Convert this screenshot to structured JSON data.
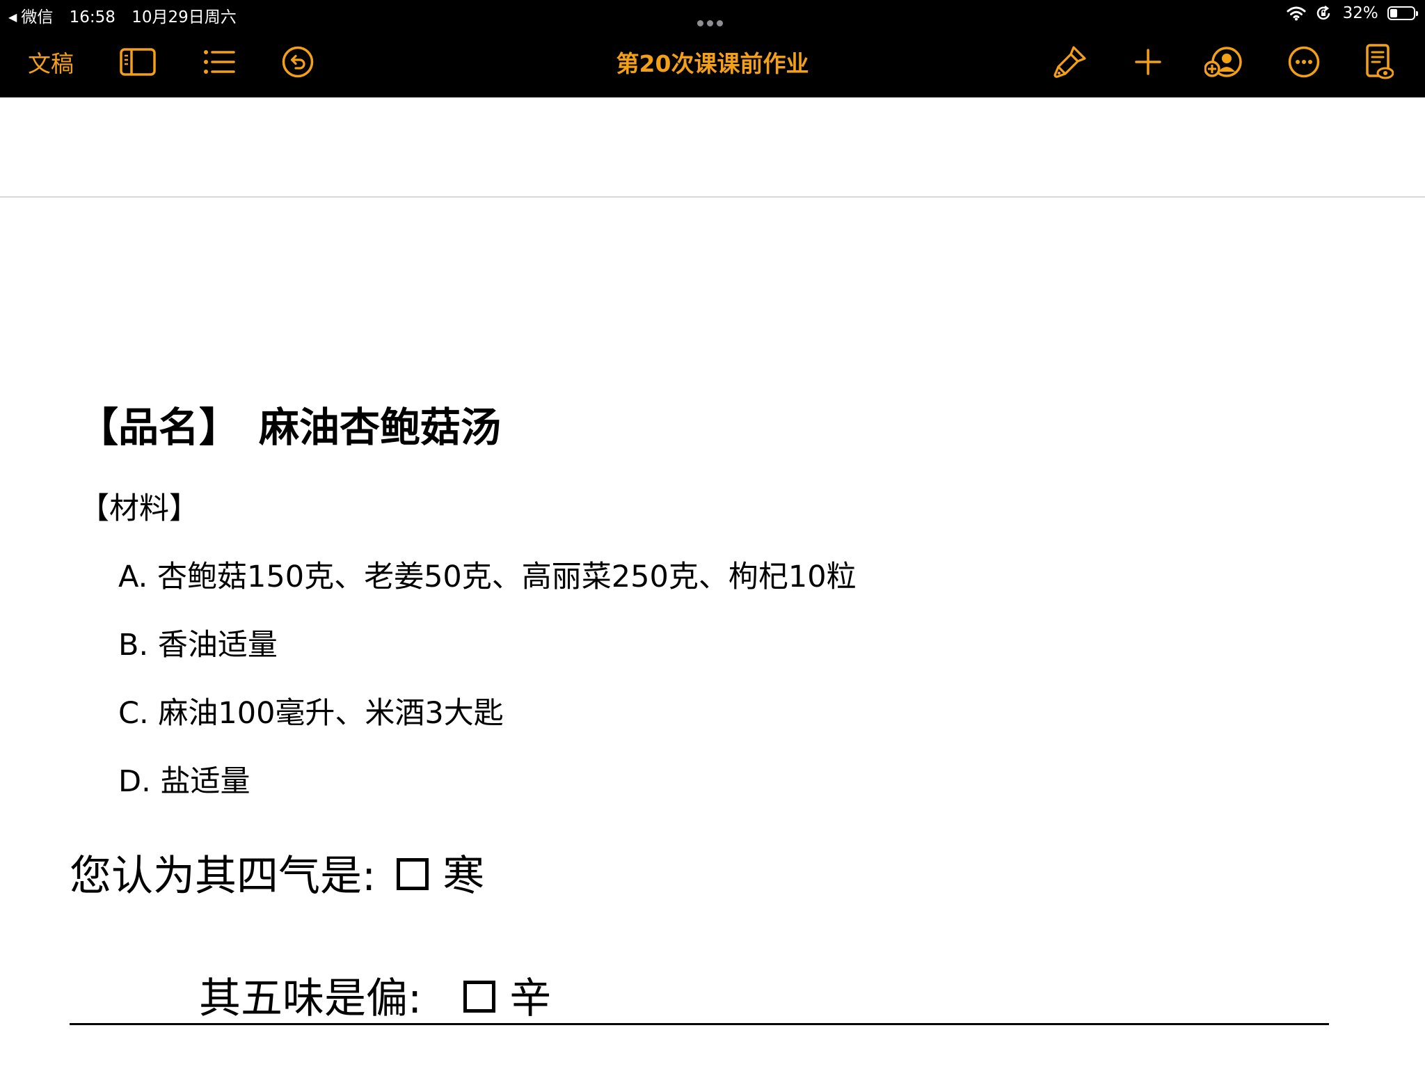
{
  "status_bar": {
    "back_app": "微信",
    "time": "16:58",
    "date": "10月29日周六",
    "battery": "32%",
    "battery_level": 0.32
  },
  "toolbar": {
    "documents_label": "文稿",
    "doc_title": "第20次课课前作业",
    "accent_color": "#f4a016",
    "icons": [
      "sidebar-icon",
      "list-icon",
      "undo-icon",
      "brush-icon",
      "plus-icon",
      "collaborate-icon",
      "more-icon",
      "reading-view-icon"
    ]
  },
  "document": {
    "title_bracket": "【品名】",
    "title_name": "麻油杏鲍菇汤",
    "materials_label": "【材料】",
    "ingredients": [
      "A. 杏鲍菇150克、老姜50克、高丽菜250克、枸杞10粒",
      "B. 香油适量",
      "C. 麻油100毫升、米酒3大匙",
      "D. 盐适量"
    ],
    "question_qi": {
      "prompt": "您认为其四气是:",
      "option": "寒"
    },
    "question_flavor": {
      "prompt": "其五味是偏:",
      "option": "辛"
    }
  }
}
